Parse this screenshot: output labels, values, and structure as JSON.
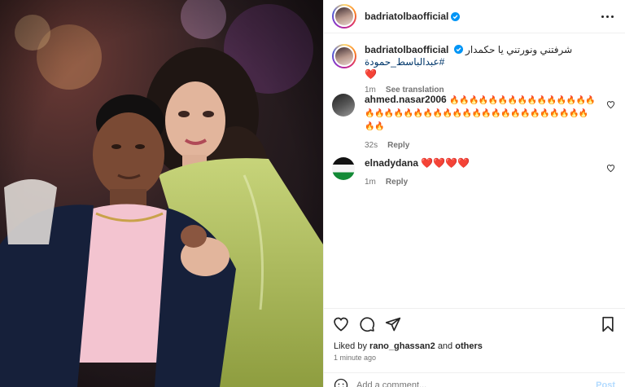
{
  "post": {
    "username": "badriatolbaofficial",
    "verified": true,
    "more_icon": "more-horizontal-icon"
  },
  "caption": {
    "username": "badriatolbaofficial",
    "text": "شرفتني ونورتني يا حكمدار",
    "hashtag": "#عبدالباسط_حمودة",
    "emoji": "❤️",
    "time": "1m",
    "see_translation": "See translation"
  },
  "comments": [
    {
      "username": "ahmed.nasar2006",
      "text": "🔥🔥🔥🔥🔥🔥🔥🔥🔥🔥🔥🔥🔥🔥🔥🔥🔥🔥🔥🔥🔥🔥🔥🔥🔥🔥🔥🔥🔥🔥🔥🔥🔥🔥🔥🔥🔥🔥🔥🔥",
      "time": "32s",
      "reply": "Reply"
    },
    {
      "username": "elnadydana",
      "text": "❤️❤️❤️❤️",
      "time": "1m",
      "reply": "Reply"
    }
  ],
  "likes": {
    "prefix": "Liked by",
    "user": "rano_ghassan2",
    "and": "and",
    "others": "others",
    "time_ago": "1 minute ago"
  },
  "add_comment": {
    "placeholder": "Add a comment...",
    "post_label": "Post"
  },
  "colors": {
    "verified": "#0095f6",
    "heart": "#ed4956",
    "hashtag": "#00376b",
    "muted": "#737373"
  }
}
